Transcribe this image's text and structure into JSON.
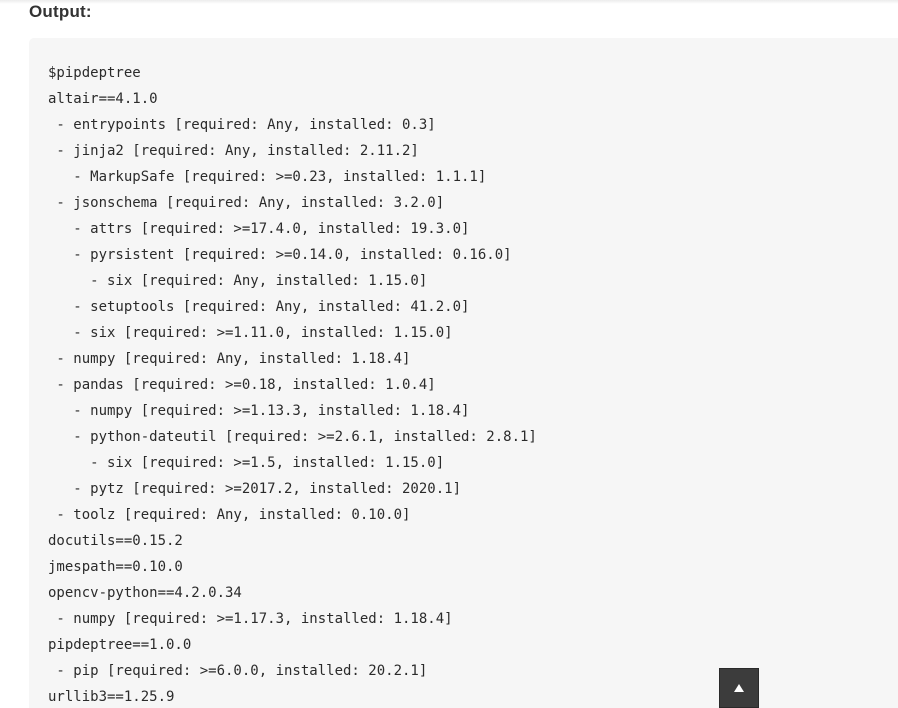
{
  "section_label": "Output:",
  "code_lines": [
    "$pipdeptree",
    "altair==4.1.0",
    " - entrypoints [required: Any, installed: 0.3]",
    " - jinja2 [required: Any, installed: 2.11.2]",
    "   - MarkupSafe [required: >=0.23, installed: 1.1.1]",
    " - jsonschema [required: Any, installed: 3.2.0]",
    "   - attrs [required: >=17.4.0, installed: 19.3.0]",
    "   - pyrsistent [required: >=0.14.0, installed: 0.16.0]",
    "     - six [required: Any, installed: 1.15.0]",
    "   - setuptools [required: Any, installed: 41.2.0]",
    "   - six [required: >=1.11.0, installed: 1.15.0]",
    " - numpy [required: Any, installed: 1.18.4]",
    " - pandas [required: >=0.18, installed: 1.0.4]",
    "   - numpy [required: >=1.13.3, installed: 1.18.4]",
    "   - python-dateutil [required: >=2.6.1, installed: 2.8.1]",
    "     - six [required: >=1.5, installed: 1.15.0]",
    "   - pytz [required: >=2017.2, installed: 2020.1]",
    " - toolz [required: Any, installed: 0.10.0]",
    "docutils==0.15.2",
    "jmespath==0.10.0",
    "opencv-python==4.2.0.34",
    " - numpy [required: >=1.17.3, installed: 1.18.4]",
    "pipdeptree==1.0.0",
    " - pip [required: >=6.0.0, installed: 20.2.1]",
    "urllib3==1.25.9"
  ],
  "scroll_top_button": {
    "icon": "arrow-up-icon"
  },
  "colors": {
    "code_background": "#f6f6f6",
    "button_background": "#3c3c3c",
    "text": "#2b2b2b"
  }
}
